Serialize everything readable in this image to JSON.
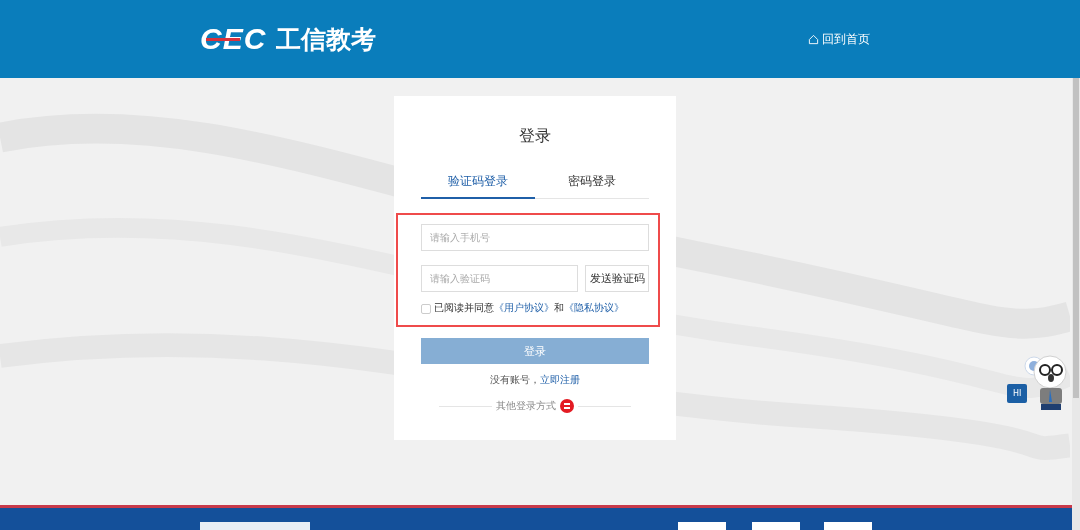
{
  "header": {
    "logo_mark": "CEC",
    "logo_text": "工信教考",
    "home_link": "回到首页"
  },
  "login": {
    "title": "登录",
    "tabs": [
      {
        "label": "验证码登录",
        "selected": true
      },
      {
        "label": "密码登录",
        "selected": false
      }
    ],
    "phone_field": {
      "placeholder": "请输入手机号"
    },
    "code_field": {
      "placeholder": "请输入验证码"
    },
    "send_code_button": "发送验证码",
    "agreement": {
      "checked": false,
      "text": "已阅读并同意",
      "user_agreement": "《用户协议》",
      "and": "和",
      "privacy_agreement": "《隐私协议》"
    },
    "submit_button": "登录",
    "register": {
      "text": "没有账号，",
      "link": "立即注册"
    },
    "other_methods": "其他登录方式"
  },
  "assistant": {
    "greeting": "HI"
  }
}
